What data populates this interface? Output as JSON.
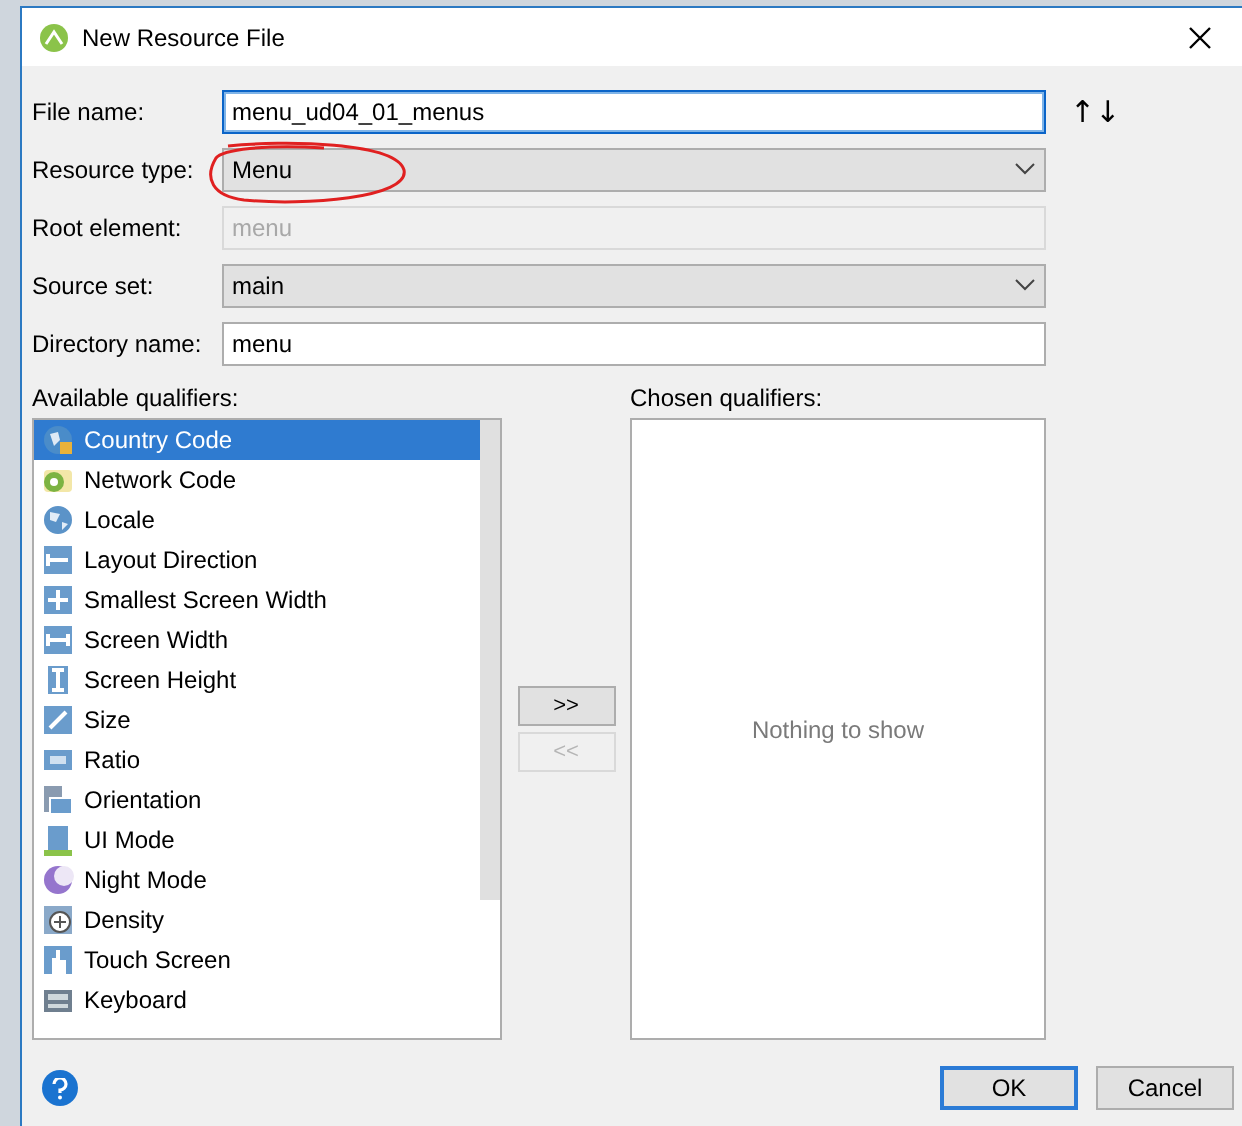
{
  "window": {
    "title": "New Resource File"
  },
  "form": {
    "fields": [
      {
        "label": "File name:",
        "kind": "text",
        "value": "menu_ud04_01_menus",
        "focused": true,
        "disabled": false
      },
      {
        "label": "Resource type:",
        "kind": "dropdown",
        "value": "Menu"
      },
      {
        "label": "Root element:",
        "kind": "text",
        "value": "menu",
        "focused": false,
        "disabled": true
      },
      {
        "label": "Source set:",
        "kind": "dropdown",
        "value": "main"
      },
      {
        "label": "Directory name:",
        "kind": "text",
        "value": "menu",
        "focused": false,
        "disabled": false
      }
    ],
    "sort_button": "↑↓"
  },
  "available": {
    "label": "Available qualifiers:",
    "items": [
      {
        "label": "Country Code",
        "selected": true
      },
      {
        "label": "Network Code",
        "selected": false
      },
      {
        "label": "Locale",
        "selected": false
      },
      {
        "label": "Layout Direction",
        "selected": false
      },
      {
        "label": "Smallest Screen Width",
        "selected": false
      },
      {
        "label": "Screen Width",
        "selected": false
      },
      {
        "label": "Screen Height",
        "selected": false
      },
      {
        "label": "Size",
        "selected": false
      },
      {
        "label": "Ratio",
        "selected": false
      },
      {
        "label": "Orientation",
        "selected": false
      },
      {
        "label": "UI Mode",
        "selected": false
      },
      {
        "label": "Night Mode",
        "selected": false
      },
      {
        "label": "Density",
        "selected": false
      },
      {
        "label": "Touch Screen",
        "selected": false
      },
      {
        "label": "Keyboard",
        "selected": false
      }
    ]
  },
  "move_buttons": [
    {
      "label": ">>",
      "disabled": false
    },
    {
      "label": "<<",
      "disabled": true
    }
  ],
  "chosen": {
    "label": "Chosen qualifiers:",
    "empty_text": "Nothing to show"
  },
  "buttons": [
    {
      "label": "OK",
      "default": true
    },
    {
      "label": "Cancel",
      "default": false
    }
  ]
}
